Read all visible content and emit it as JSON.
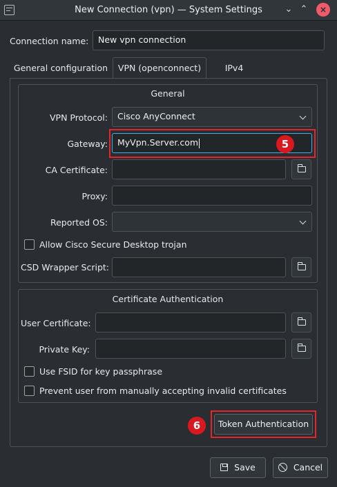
{
  "window": {
    "title": "New Connection (vpn) — System Settings",
    "icons": {
      "app": "app-menu-icon",
      "minimize": "chevron-down-icon",
      "maximize": "chevron-up-icon",
      "close": "close-icon"
    },
    "glyphs": {
      "minimize": "⌄",
      "maximize": "⌃",
      "close": "×"
    },
    "close_color": "#ef5b6a"
  },
  "connection": {
    "label": "Connection name:",
    "value": "New vpn connection"
  },
  "tabs": [
    {
      "label": "General configuration",
      "active": false
    },
    {
      "label": "VPN (openconnect)",
      "active": true
    },
    {
      "label": "IPv4",
      "active": false
    }
  ],
  "general": {
    "title": "General",
    "vpn_protocol": {
      "label": "VPN Protocol:",
      "value": "Cisco AnyConnect"
    },
    "gateway": {
      "label": "Gateway:",
      "value": "MyVpn.Server.com"
    },
    "ca_certificate": {
      "label": "CA Certificate:",
      "value": ""
    },
    "proxy": {
      "label": "Proxy:",
      "value": ""
    },
    "reported_os": {
      "label": "Reported OS:",
      "value": ""
    },
    "allow_csd": {
      "label": "Allow Cisco Secure Desktop trojan",
      "checked": false
    },
    "csd_wrapper": {
      "label": "CSD Wrapper Script:",
      "value": ""
    }
  },
  "cert_auth": {
    "title": "Certificate Authentication",
    "user_certificate": {
      "label": "User Certificate:",
      "value": ""
    },
    "private_key": {
      "label": "Private Key:",
      "value": ""
    },
    "use_fsid": {
      "label": "Use FSID for key passphrase",
      "checked": false
    },
    "prevent_invalid": {
      "label": "Prevent user from manually accepting invalid certificates",
      "checked": false
    }
  },
  "token_button": "Token Authentication",
  "footer": {
    "save_label": "Save",
    "save_icon": "save-icon",
    "cancel_label": "Cancel",
    "cancel_icon": "cancel-icon"
  },
  "annotations": {
    "step_gateway": "5",
    "step_token": "6",
    "color": "#d9181f"
  }
}
